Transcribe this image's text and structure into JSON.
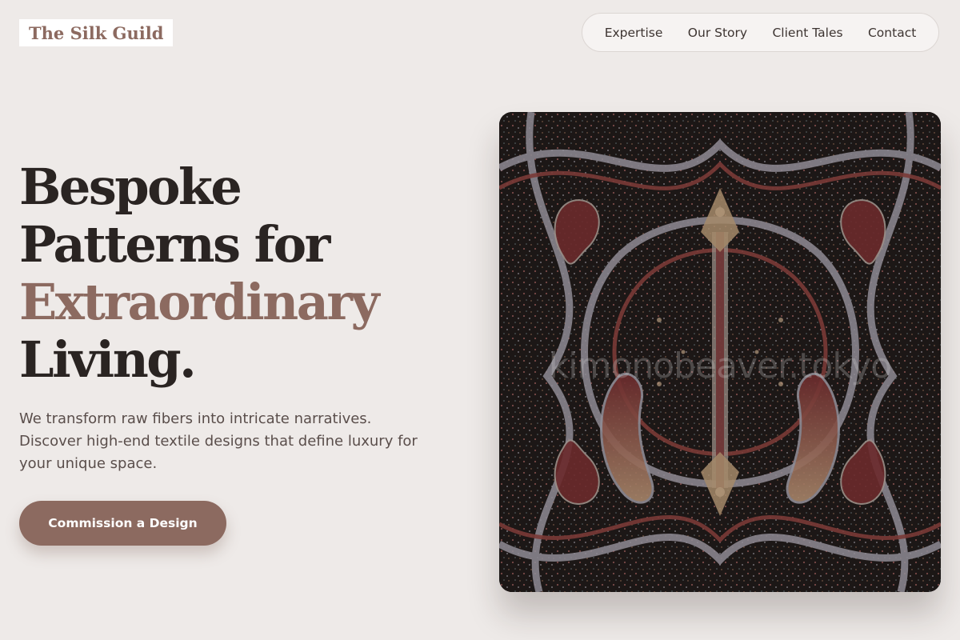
{
  "brand": {
    "name": "The Silk Guild"
  },
  "nav": {
    "items": [
      "Expertise",
      "Our Story",
      "Client Tales",
      "Contact"
    ]
  },
  "hero": {
    "headline_lines": [
      "Bespoke",
      "Patterns for",
      "Extraordinary",
      "Living."
    ],
    "subtitle": "We transform raw fibers into intricate narratives. Discover high-end textile designs that define luxury for your unique space.",
    "cta_label": "Commission a Design",
    "image_watermark": "kimonobeaver.tokyo"
  },
  "colors": {
    "background": "#eeeae8",
    "accent": "#8c6a60",
    "text_dark": "#2a2422",
    "text_body": "#5a4e4b"
  },
  "icons": {
    "hero_image": "paisley-textile-image"
  }
}
